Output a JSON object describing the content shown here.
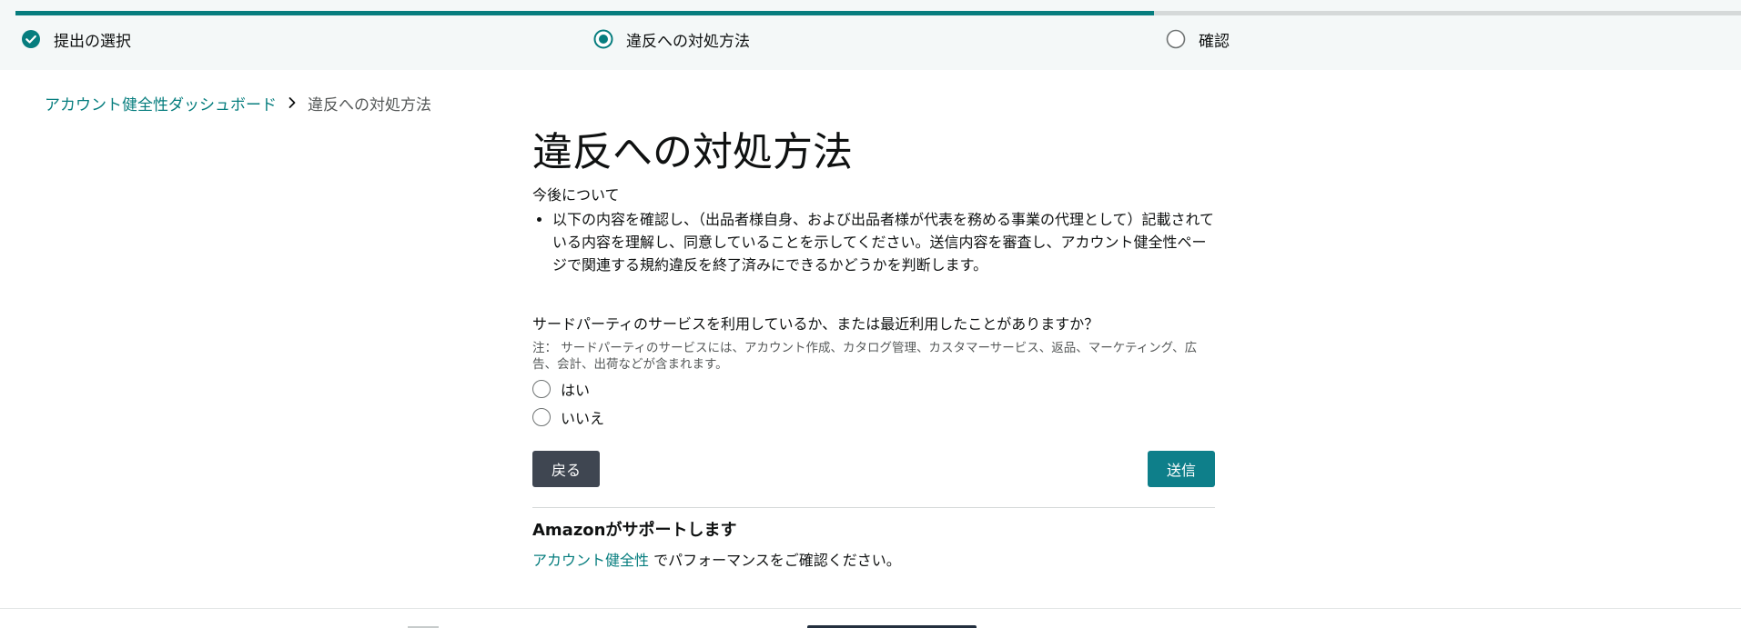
{
  "stepper": {
    "progress": 0.66,
    "steps": [
      {
        "label": "提出の選択",
        "state": "complete"
      },
      {
        "label": "違反への対処方法",
        "state": "current"
      },
      {
        "label": "確認",
        "state": "upcoming"
      }
    ]
  },
  "breadcrumb": {
    "parent": "アカウント健全性ダッシュボード",
    "current": "違反への対処方法"
  },
  "main": {
    "title": "違反への対処方法",
    "section_title": "今後について",
    "bullets": [
      "以下の内容を確認し、（出品者様自身、および出品者様が代表を務める事業の代理として）記載されている内容を理解し、同意していることを示してください。送信内容を審査し、アカウント健全性ページで関連する規約違反を終了済みにできるかどうかを判断します。"
    ],
    "question": "サードパーティのサービスを利用しているか、または最近利用したことがありますか？",
    "note": "注： サードパーティのサービスには、アカウント作成、カタログ管理、カスタマーサービス、返品、マーケティング、広告、会計、出荷などが含まれます。",
    "options": [
      "はい",
      "いいえ"
    ],
    "back_label": "戻る",
    "submit_label": "送信"
  },
  "support": {
    "title": "Amazonがサポートします",
    "link_text": "アカウント健全性",
    "text": " でパフォーマンスをご確認ください。"
  },
  "colors": {
    "accent": "#067d7e",
    "back_button": "#3f4651",
    "submit_button": "#0e7f8a"
  }
}
